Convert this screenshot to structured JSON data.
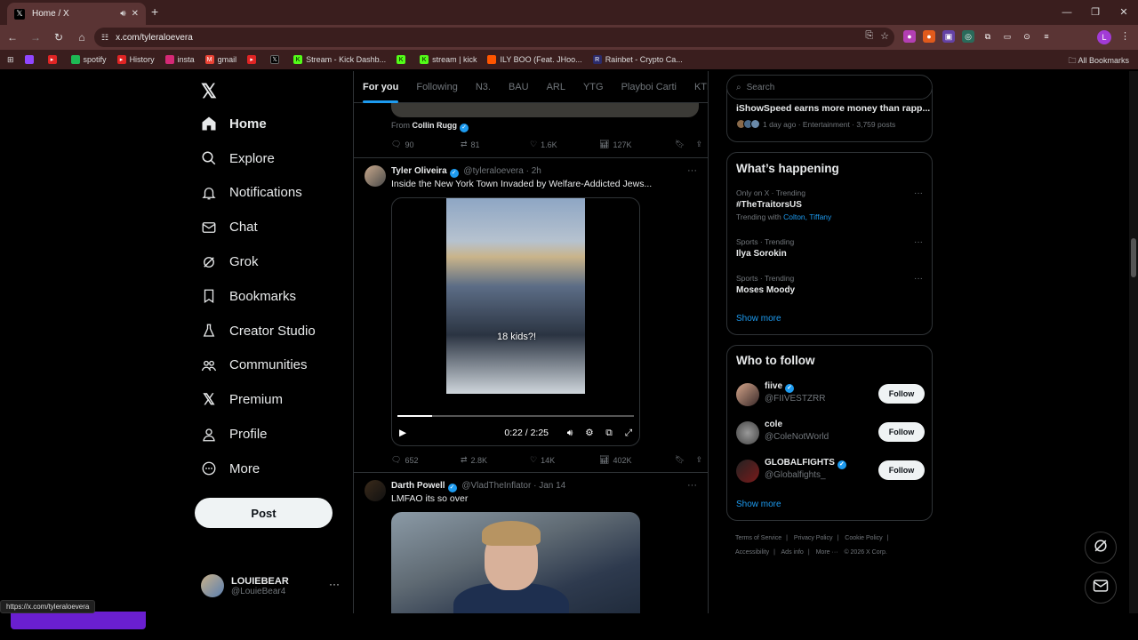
{
  "browser": {
    "tab_title": "Home / X",
    "url": "x.com/tyleraloevera",
    "status_url": "https://x.com/tyleraloevera",
    "profile_initial": "L",
    "bookmarks": [
      {
        "label": "spotify",
        "color": "#1db954"
      },
      {
        "label": "History",
        "color": "#e02424"
      },
      {
        "label": "insta",
        "color": "#d62976"
      },
      {
        "label": "gmail",
        "color": "#ea4335"
      },
      {
        "label": "",
        "color": "#e02424"
      },
      {
        "label": "",
        "color": "#000000"
      },
      {
        "label": "Stream - Kick Dashb...",
        "color": "#53fc18"
      },
      {
        "label": "",
        "color": "#53fc18"
      },
      {
        "label": "stream | kick",
        "color": "#53fc18"
      },
      {
        "label": "ILY BOO (Feat. JHoo...",
        "color": "#ff5500"
      },
      {
        "label": "Rainbet - Crypto Ca...",
        "color": "#2b2b6b"
      }
    ],
    "all_bookmarks": "All Bookmarks"
  },
  "nav": {
    "items": [
      {
        "label": "Home",
        "icon": "home-icon"
      },
      {
        "label": "Explore",
        "icon": "search-icon"
      },
      {
        "label": "Notifications",
        "icon": "bell-icon"
      },
      {
        "label": "Chat",
        "icon": "mail-icon"
      },
      {
        "label": "Grok",
        "icon": "grok-icon"
      },
      {
        "label": "Bookmarks",
        "icon": "bookmark-icon"
      },
      {
        "label": "Creator Studio",
        "icon": "flask-icon"
      },
      {
        "label": "Communities",
        "icon": "communities-icon"
      },
      {
        "label": "Premium",
        "icon": "x-logo-icon"
      },
      {
        "label": "Profile",
        "icon": "person-icon"
      },
      {
        "label": "More",
        "icon": "more-circle-icon"
      }
    ],
    "post_label": "Post",
    "account": {
      "name": "LOUIEBEAR",
      "handle": "@LouieBear4"
    }
  },
  "feed": {
    "tabs": [
      "For you",
      "Following",
      "N3.",
      "BAU",
      "ARL",
      "YTG",
      "Playboi Carti",
      "KTF"
    ],
    "prev_tweet": {
      "from_label": "From",
      "from_name": "Collin Rugg",
      "stats": {
        "replies": "90",
        "reposts": "81",
        "likes": "1.6K",
        "views": "127K"
      }
    },
    "tweet1": {
      "name": "Tyler Oliveira",
      "handle": "@tyleraloevera",
      "time": "· 2h",
      "text": "Inside the New York Town Invaded by Welfare-Addicted Jews...",
      "video_caption": "18 kids?!",
      "video_time": "0:22 / 2:25",
      "video_progress": 0.147,
      "stats": {
        "replies": "652",
        "reposts": "2.8K",
        "likes": "14K",
        "views": "402K"
      }
    },
    "tweet2": {
      "name": "Darth Powell",
      "handle": "@VladTheInflator",
      "time": "· Jan 14",
      "text": "LMFAO its so over"
    }
  },
  "sidebar": {
    "search_placeholder": "Search",
    "top_story": {
      "title": "iShowSpeed earns more money than rapp...",
      "meta": "1 day ago · Entertainment · 3,759 posts"
    },
    "happening": {
      "title": "What’s happening",
      "trends": [
        {
          "category": "Only on X · Trending",
          "name": "#TheTraitorsUS",
          "with_label": "Trending with",
          "with": "Colton, Tiffany"
        },
        {
          "category": "Sports · Trending",
          "name": "Ilya Sorokin"
        },
        {
          "category": "Sports · Trending",
          "name": "Moses Moody"
        }
      ],
      "show_more": "Show more"
    },
    "who_to_follow": {
      "title": "Who to follow",
      "accounts": [
        {
          "name": "fiive",
          "handle": "@FIIVESTZRR",
          "verified": true,
          "button": "Follow"
        },
        {
          "name": "cole",
          "handle": "@ColeNotWorld",
          "verified": false,
          "button": "Follow"
        },
        {
          "name": "GLOBALFIGHTS",
          "handle": "@Globalfights_",
          "verified": true,
          "button": "Follow"
        }
      ],
      "show_more": "Show more"
    },
    "footer": [
      "Terms of Service",
      "|",
      "Privacy Policy",
      "|",
      "Cookie Policy",
      "|",
      "Accessibility",
      "|",
      "Ads info",
      "|",
      "More ···",
      "© 2026 X Corp."
    ]
  }
}
